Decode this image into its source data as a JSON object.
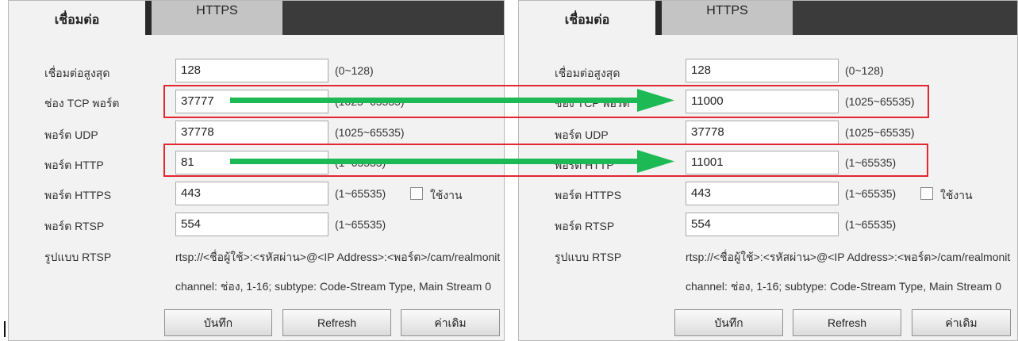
{
  "tabs": {
    "active": "เชื่อมต่อ",
    "inactive": "HTTPS"
  },
  "left": {
    "max_connection": {
      "label": "เชื่อมต่อสูงสุด",
      "value": "128",
      "range": "(0~128)"
    },
    "tcp_port": {
      "label": "ช่อง TCP พอร์ต",
      "value": "37777",
      "range": "(1025~65535)"
    },
    "udp_port": {
      "label": "พอร์ต UDP",
      "value": "37778",
      "range": "(1025~65535)"
    },
    "http_port": {
      "label": "พอร์ต HTTP",
      "value": "81",
      "range": "(1~65535)"
    },
    "https_port": {
      "label": "พอร์ต HTTPS",
      "value": "443",
      "range": "(1~65535)",
      "enable_label": "ใช้งาน"
    },
    "rtsp_port": {
      "label": "พอร์ต RTSP",
      "value": "554",
      "range": "(1~65535)"
    },
    "rtsp_format": {
      "label": "รูปแบบ RTSP",
      "line1": "rtsp://<ชื่อผู้ใช้>:<รหัสผ่าน>@<IP Address>:<พอร์ต>/cam/realmonit",
      "line2": "channel: ช่อง, 1-16; subtype: Code-Stream Type, Main Stream 0"
    },
    "buttons": {
      "save": "บันทึก",
      "refresh": "Refresh",
      "default": "ค่าเดิม"
    }
  },
  "right": {
    "max_connection": {
      "label": "เชื่อมต่อสูงสุด",
      "value": "128",
      "range": "(0~128)"
    },
    "tcp_port": {
      "label": "ช่อง TCP พอร์ต",
      "value": "11000",
      "range": "(1025~65535)"
    },
    "udp_port": {
      "label": "พอร์ต UDP",
      "value": "37778",
      "range": "(1025~65535)"
    },
    "http_port": {
      "label": "พอร์ต HTTP",
      "value": "11001",
      "range": "(1~65535)"
    },
    "https_port": {
      "label": "พอร์ต HTTPS",
      "value": "443",
      "range": "(1~65535)",
      "enable_label": "ใช้งาน"
    },
    "rtsp_port": {
      "label": "พอร์ต RTSP",
      "value": "554",
      "range": "(1~65535)"
    },
    "rtsp_format": {
      "label": "รูปแบบ RTSP",
      "line1": "rtsp://<ชื่อผู้ใช้>:<รหัสผ่าน>@<IP Address>:<พอร์ต>/cam/realmonit",
      "line2": "channel: ช่อง, 1-16; subtype: Code-Stream Type, Main Stream 0"
    },
    "buttons": {
      "save": "บันทึก",
      "refresh": "Refresh",
      "default": "ค่าเดิม"
    }
  },
  "colors": {
    "highlight": "#e3262f",
    "arrow": "#1db954",
    "tabbar": "#3b3b3b",
    "panel": "#f2f2f2"
  },
  "icons": {
    "annotation_arrow": "arrow-right-icon"
  }
}
